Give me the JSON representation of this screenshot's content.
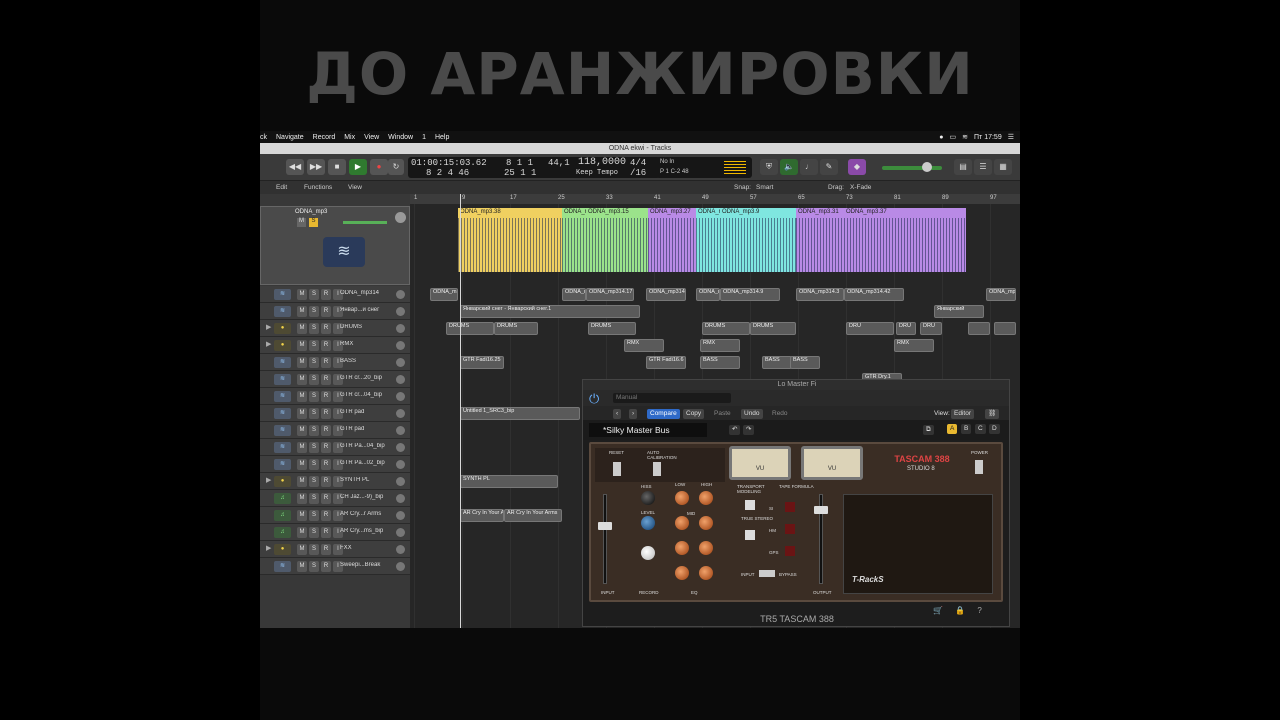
{
  "caption": "ДО АРАНЖИРОВКИ",
  "menubar": {
    "items": [
      "ck",
      "Navigate",
      "Record",
      "Mix",
      "View",
      "Window",
      "1",
      "Help"
    ],
    "clock": "Пт 17:59"
  },
  "window_title": "ODNA ekwi - Tracks",
  "lcd": {
    "time": "01:00:15:03.62",
    "time2": "8 2 4 46",
    "bars": "8 1 1",
    "bars2": "25 1 1",
    "beat": "1",
    "beat2": "1",
    "tempo_bpm": "44,1",
    "tempo": "118,0000",
    "tempo_mode": "Keep Tempo",
    "sig": "4/4",
    "div": "/16",
    "key1": "No In",
    "key2": "P 1 C-2 48"
  },
  "toolbar2": {
    "edit": "Edit",
    "functions": "Functions",
    "view": "View",
    "snap_label": "Snap:",
    "snap": "Smart",
    "drag_label": "Drag:",
    "drag": "X-Fade"
  },
  "ruler": [
    "1",
    "9",
    "17",
    "25",
    "33",
    "41",
    "49",
    "57",
    "65",
    "73",
    "81",
    "89",
    "97"
  ],
  "main_track": {
    "name": "ODNA_mp3",
    "flags": [
      "M",
      "S"
    ]
  },
  "tracks": [
    {
      "name": "ODNA_mp314",
      "icon": "wave",
      "tri": ""
    },
    {
      "name": "Январ...й снег",
      "icon": "wave",
      "tri": ""
    },
    {
      "name": "DRUMS",
      "icon": "drum",
      "tri": "▶"
    },
    {
      "name": "RMX",
      "icon": "drum",
      "tri": "▶"
    },
    {
      "name": "BASS",
      "icon": "wave",
      "tri": ""
    },
    {
      "name": "GTR cr...20_bip",
      "icon": "wave",
      "tri": ""
    },
    {
      "name": "GTR cr...04_bip",
      "icon": "wave",
      "tri": ""
    },
    {
      "name": "GTR pad",
      "icon": "wave",
      "tri": ""
    },
    {
      "name": "GTR pad",
      "icon": "wave",
      "tri": ""
    },
    {
      "name": "GTR Pa...04_bip",
      "icon": "wave",
      "tri": ""
    },
    {
      "name": "GTR Pa...02_bip",
      "icon": "wave",
      "tri": ""
    },
    {
      "name": "SYNTH PL",
      "icon": "drum",
      "tri": "▶"
    },
    {
      "name": "CH Jaz...-9)_bip",
      "icon": "note",
      "tri": ""
    },
    {
      "name": "AR Cry...r Arms",
      "icon": "note",
      "tri": ""
    },
    {
      "name": "AR Cry...ms_bip",
      "icon": "note",
      "tri": ""
    },
    {
      "name": "FXX",
      "icon": "drum",
      "tri": "▶"
    },
    {
      "name": "Sweepi...Break",
      "icon": "wave",
      "tri": ""
    }
  ],
  "clips": [
    {
      "label": "ODNA_mp3.38",
      "color": "#f0d060"
    },
    {
      "label": "ODNA_m",
      "color": "#9be38b"
    },
    {
      "label": "ODNA_mp3.15",
      "color": "#9be38b"
    },
    {
      "label": "ODNA_mp3.27",
      "color": "#b98ae6"
    },
    {
      "label": "ODNA_m",
      "color": "#7fe6e0"
    },
    {
      "label": "ODNA_mp3.9",
      "color": "#7fe6e0"
    },
    {
      "label": "ODNA_mp3.31",
      "color": "#b98ae6"
    },
    {
      "label": "ODNA_mp3.37",
      "color": "#b98ae6"
    }
  ],
  "lane_labels": {
    "r0": [
      "ODNA_m",
      "ODNA_m",
      "ODNA_mp314.17",
      "ODNA_mp314.29",
      "ODNA_m",
      "ODNA_mp314.9",
      "ODNA_mp314.3",
      "ODNA_mp314.42",
      "ODNA_mp314.41"
    ],
    "r1": [
      "Январский снег - Январский снег.1",
      "Январский"
    ],
    "r2": [
      "DRUMS",
      "DRUMS",
      "DRUMS",
      "DRUMS",
      "DRUMS",
      "DRU",
      "DRU",
      "DRU"
    ],
    "r3": [
      "RMX",
      "RMX",
      "RMX"
    ],
    "r4": [
      "GTR Fadi16.25",
      "GTR Fadi16.6",
      "BASS",
      "BASS",
      "BASS"
    ],
    "r5": [
      "GTR Dry.1"
    ],
    "r7": [
      "Untitled 1_SRC3_bip"
    ],
    "r11": [
      "SYNTH PL"
    ],
    "r13": [
      "AR Cry In Your Ar",
      "AR Cry In Your Arms"
    ]
  },
  "plugin": {
    "title": "Lo Master Fi",
    "preset_menu": "Manual",
    "compare": "Compare",
    "copy": "Copy",
    "paste": "Paste",
    "undo": "Undo",
    "redo": "Redo",
    "view_label": "View:",
    "view": "Editor",
    "preset": "*Silky Master Bus",
    "slots": [
      "A",
      "B",
      "C",
      "D"
    ],
    "labels": {
      "reset": "RESET",
      "auto": "AUTO CALIBRATION",
      "transport": "TRANSPORT MODELING",
      "tape": "TAPE FORMULA",
      "true_stereo": "TRUE STEREO",
      "power": "POWER",
      "input": "INPUT",
      "record": "RECORD",
      "output": "OUTPUT",
      "bypass": "BYPASS",
      "hiss": "HISS",
      "level": "LEVEL",
      "low": "LOW",
      "mid": "MID",
      "high": "HIGH",
      "eq": "EQ",
      "vu": "VU"
    },
    "model": "TASCAM 388",
    "model_sub": "STUDIO 8",
    "tape_options": [
      "SI",
      "HM",
      "GPS"
    ],
    "tracks_logo": "T-RackS",
    "footer": "TR5 TASCAM 388"
  }
}
